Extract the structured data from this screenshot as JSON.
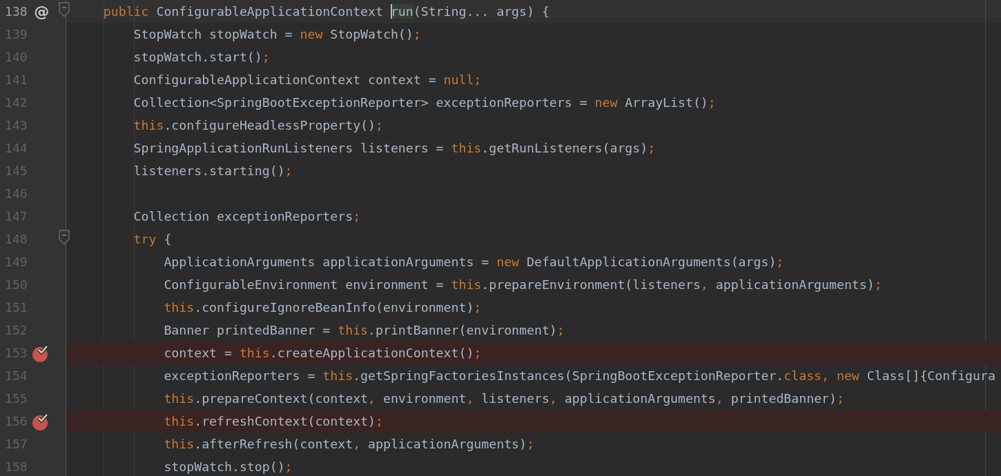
{
  "lines": [
    {
      "number": "138",
      "current": true,
      "breakpoint": false,
      "annotation": "@",
      "fold": true,
      "segments": [
        {
          "text": "    public",
          "kind": "keyword"
        },
        {
          "text": " ConfigurableApplicationContext ",
          "kind": "plain"
        },
        {
          "text": "run",
          "kind": "usage"
        },
        {
          "text": "(String... args) {",
          "kind": "plain"
        }
      ]
    },
    {
      "number": "139",
      "current": false,
      "breakpoint": false,
      "fold": false,
      "segments": [
        {
          "text": "        StopWatch stopWatch = ",
          "kind": "plain"
        },
        {
          "text": "new",
          "kind": "keyword"
        },
        {
          "text": " StopWatch()",
          "kind": "plain"
        },
        {
          "text": ";",
          "kind": "keyword"
        }
      ]
    },
    {
      "number": "140",
      "current": false,
      "breakpoint": false,
      "fold": false,
      "segments": [
        {
          "text": "        stopWatch.start()",
          "kind": "plain"
        },
        {
          "text": ";",
          "kind": "keyword"
        }
      ]
    },
    {
      "number": "141",
      "current": false,
      "breakpoint": false,
      "fold": false,
      "segments": [
        {
          "text": "        ConfigurableApplicationContext context = ",
          "kind": "plain"
        },
        {
          "text": "null",
          "kind": "keyword"
        },
        {
          "text": ";",
          "kind": "keyword"
        }
      ]
    },
    {
      "number": "142",
      "current": false,
      "breakpoint": false,
      "fold": false,
      "segments": [
        {
          "text": "        Collection<SpringBootExceptionReporter> exceptionReporters = ",
          "kind": "plain"
        },
        {
          "text": "new",
          "kind": "keyword"
        },
        {
          "text": " ArrayList()",
          "kind": "plain"
        },
        {
          "text": ";",
          "kind": "keyword"
        }
      ]
    },
    {
      "number": "143",
      "current": false,
      "breakpoint": false,
      "fold": false,
      "segments": [
        {
          "text": "        this",
          "kind": "keyword"
        },
        {
          "text": ".configureHeadlessProperty()",
          "kind": "plain"
        },
        {
          "text": ";",
          "kind": "keyword"
        }
      ]
    },
    {
      "number": "144",
      "current": false,
      "breakpoint": false,
      "fold": false,
      "segments": [
        {
          "text": "        SpringApplicationRunListeners listeners = ",
          "kind": "plain"
        },
        {
          "text": "this",
          "kind": "keyword"
        },
        {
          "text": ".getRunListeners(args)",
          "kind": "plain"
        },
        {
          "text": ";",
          "kind": "keyword"
        }
      ]
    },
    {
      "number": "145",
      "current": false,
      "breakpoint": false,
      "fold": false,
      "segments": [
        {
          "text": "        listeners.starting()",
          "kind": "plain"
        },
        {
          "text": ";",
          "kind": "keyword"
        }
      ]
    },
    {
      "number": "146",
      "current": false,
      "breakpoint": false,
      "fold": false
    },
    {
      "number": "147",
      "current": false,
      "breakpoint": false,
      "fold": false,
      "segments": [
        {
          "text": "        Collection exceptionReporters",
          "kind": "plain"
        },
        {
          "text": ";",
          "kind": "keyword"
        }
      ]
    },
    {
      "number": "148",
      "current": false,
      "breakpoint": false,
      "fold": true,
      "segments": [
        {
          "text": "        try",
          "kind": "keyword"
        },
        {
          "text": " {",
          "kind": "plain"
        }
      ]
    },
    {
      "number": "149",
      "current": false,
      "breakpoint": false,
      "fold": false,
      "segments": [
        {
          "text": "            ApplicationArguments applicationArguments = ",
          "kind": "plain"
        },
        {
          "text": "new",
          "kind": "keyword"
        },
        {
          "text": " DefaultApplicationArguments(args)",
          "kind": "plain"
        },
        {
          "text": ";",
          "kind": "keyword"
        }
      ]
    },
    {
      "number": "150",
      "current": false,
      "breakpoint": false,
      "fold": false,
      "segments": [
        {
          "text": "            ConfigurableEnvironment environment = ",
          "kind": "plain"
        },
        {
          "text": "this",
          "kind": "keyword"
        },
        {
          "text": ".prepareEnvironment(listeners",
          "kind": "plain"
        },
        {
          "text": ",",
          "kind": "keyword"
        },
        {
          "text": " applicationArguments)",
          "kind": "plain"
        },
        {
          "text": ";",
          "kind": "keyword"
        }
      ]
    },
    {
      "number": "151",
      "current": false,
      "breakpoint": false,
      "fold": false,
      "segments": [
        {
          "text": "            this",
          "kind": "keyword"
        },
        {
          "text": ".configureIgnoreBeanInfo(environment)",
          "kind": "plain"
        },
        {
          "text": ";",
          "kind": "keyword"
        }
      ]
    },
    {
      "number": "152",
      "current": false,
      "breakpoint": false,
      "fold": false,
      "segments": [
        {
          "text": "            Banner printedBanner = ",
          "kind": "plain"
        },
        {
          "text": "this",
          "kind": "keyword"
        },
        {
          "text": ".printBanner(environment)",
          "kind": "plain"
        },
        {
          "text": ";",
          "kind": "keyword"
        }
      ]
    },
    {
      "number": "153",
      "current": false,
      "breakpoint": true,
      "fold": false,
      "segments": [
        {
          "text": "            context = ",
          "kind": "plain"
        },
        {
          "text": "this",
          "kind": "keyword"
        },
        {
          "text": ".createApplicationContext()",
          "kind": "plain"
        },
        {
          "text": ";",
          "kind": "keyword"
        }
      ]
    },
    {
      "number": "154",
      "current": false,
      "breakpoint": false,
      "fold": false,
      "segments": [
        {
          "text": "            exceptionReporters = ",
          "kind": "plain"
        },
        {
          "text": "this",
          "kind": "keyword"
        },
        {
          "text": ".getSpringFactoriesInstances(SpringBootExceptionReporter.",
          "kind": "plain"
        },
        {
          "text": "class",
          "kind": "keyword"
        },
        {
          "text": ", new",
          "kind": "keyword"
        },
        {
          "text": " Class[]{Configura",
          "kind": "plain"
        }
      ]
    },
    {
      "number": "155",
      "current": false,
      "breakpoint": false,
      "fold": false,
      "segments": [
        {
          "text": "            this",
          "kind": "keyword"
        },
        {
          "text": ".prepareContext(context",
          "kind": "plain"
        },
        {
          "text": ",",
          "kind": "keyword"
        },
        {
          "text": " environment",
          "kind": "plain"
        },
        {
          "text": ",",
          "kind": "keyword"
        },
        {
          "text": " listeners",
          "kind": "plain"
        },
        {
          "text": ",",
          "kind": "keyword"
        },
        {
          "text": " applicationArguments",
          "kind": "plain"
        },
        {
          "text": ",",
          "kind": "keyword"
        },
        {
          "text": " printedBanner)",
          "kind": "plain"
        },
        {
          "text": ";",
          "kind": "keyword"
        }
      ]
    },
    {
      "number": "156",
      "current": false,
      "breakpoint": true,
      "fold": false,
      "segments": [
        {
          "text": "            this",
          "kind": "keyword"
        },
        {
          "text": ".refreshContext(context)",
          "kind": "plain"
        },
        {
          "text": ";",
          "kind": "keyword"
        }
      ]
    },
    {
      "number": "157",
      "current": false,
      "breakpoint": false,
      "fold": false,
      "segments": [
        {
          "text": "            this",
          "kind": "keyword"
        },
        {
          "text": ".afterRefresh(context",
          "kind": "plain"
        },
        {
          "text": ",",
          "kind": "keyword"
        },
        {
          "text": " applicationArguments)",
          "kind": "plain"
        },
        {
          "text": ";",
          "kind": "keyword"
        }
      ]
    },
    {
      "number": "158",
      "current": false,
      "breakpoint": false,
      "fold": false,
      "segments": [
        {
          "text": "            stopWatch.stop()",
          "kind": "plain"
        },
        {
          "text": ";",
          "kind": "keyword"
        }
      ]
    }
  ]
}
